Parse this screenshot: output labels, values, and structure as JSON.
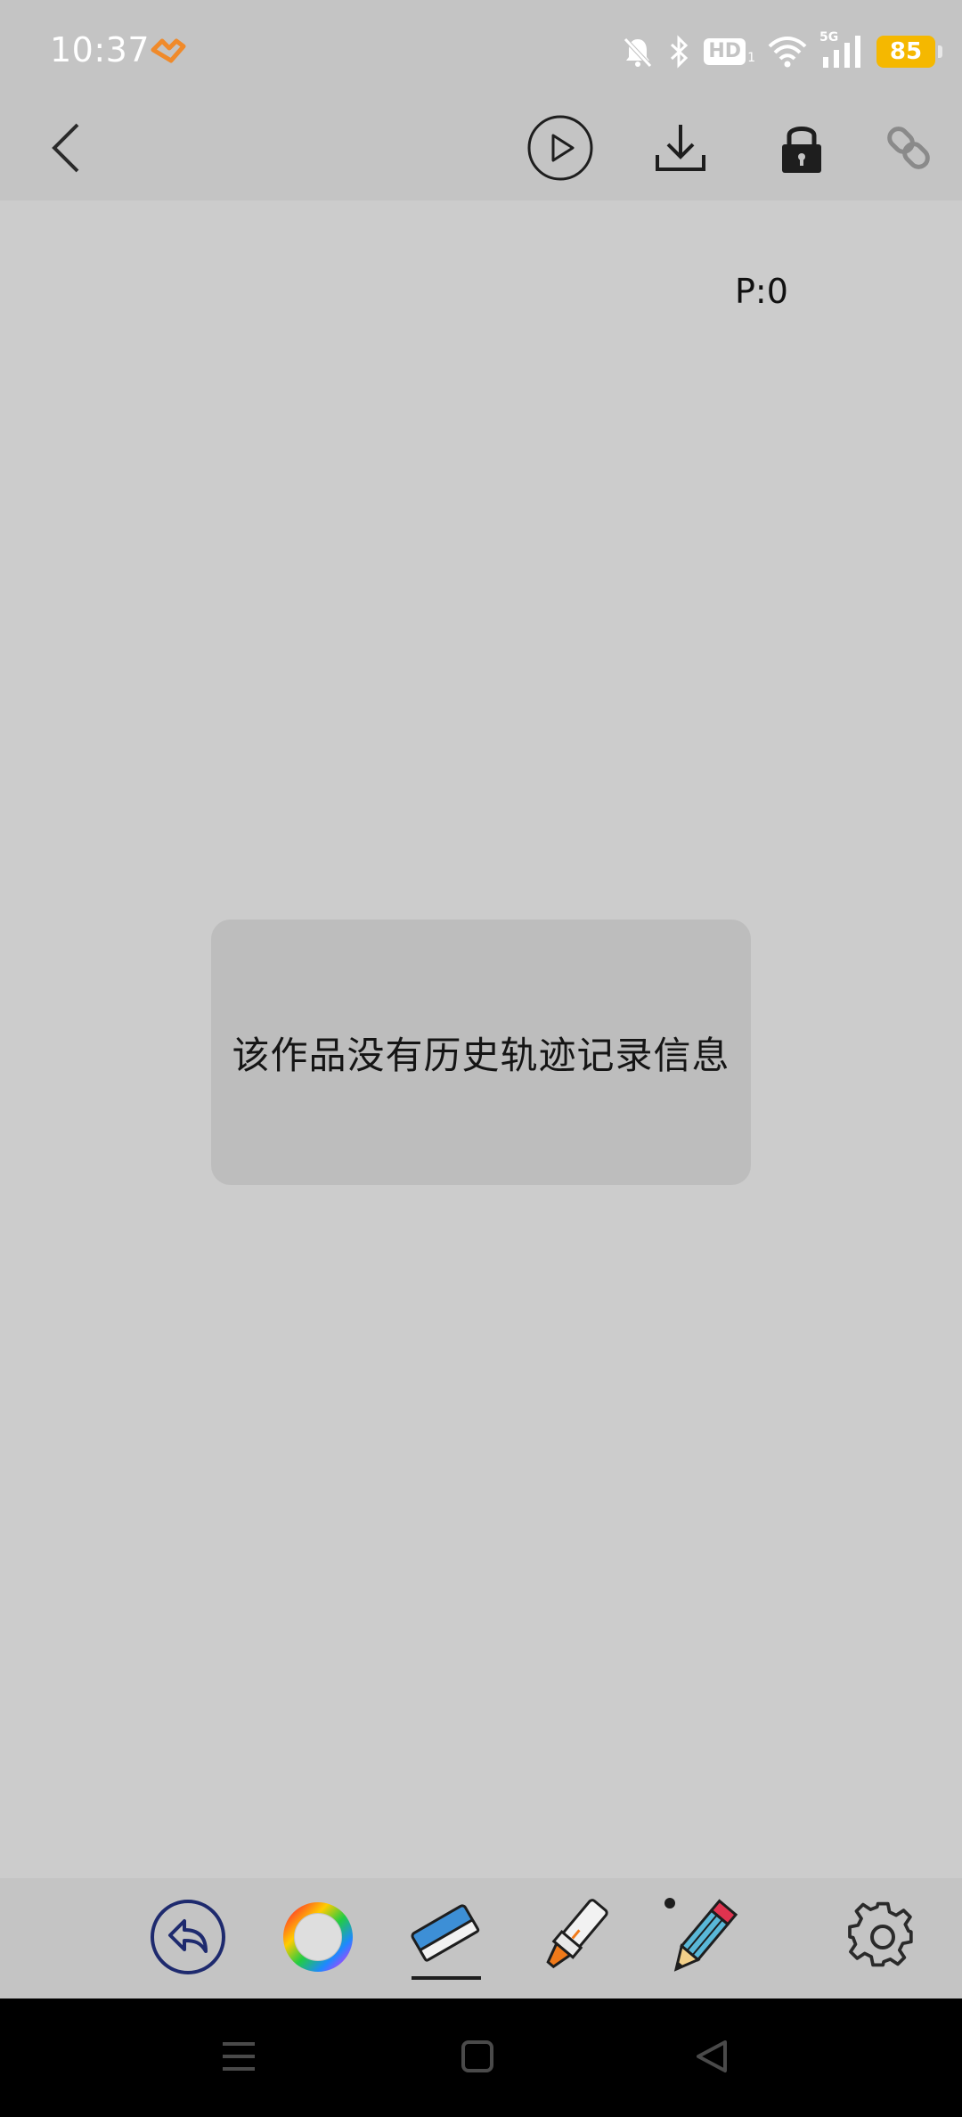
{
  "status_bar": {
    "time": "10:37",
    "network_label": "5G",
    "hd_label": "HD",
    "hd_sub": "1",
    "battery_level": "85",
    "icons": [
      "mute-bell-icon",
      "bluetooth-icon",
      "hd-icon",
      "wifi-icon",
      "signal-icon",
      "battery-icon"
    ]
  },
  "top_toolbar": {
    "icons": [
      "back-icon",
      "play-icon",
      "download-icon",
      "lock-icon",
      "link-icon"
    ]
  },
  "canvas": {
    "page_indicator": "P:0",
    "background_color": "#cccccc"
  },
  "toast": {
    "message": "该作品没有历史轨迹记录信息"
  },
  "bottom_toolbar": {
    "tools": [
      "undo-icon",
      "color-wheel-icon",
      "eraser-icon",
      "marker-icon",
      "pencil-icon",
      "settings-icon"
    ],
    "selected_tool": "eraser-icon",
    "accent_color": "#1e2a6e"
  },
  "nav_bar": {
    "icons": [
      "menu-icon",
      "home-icon",
      "back-triangle-icon"
    ]
  }
}
